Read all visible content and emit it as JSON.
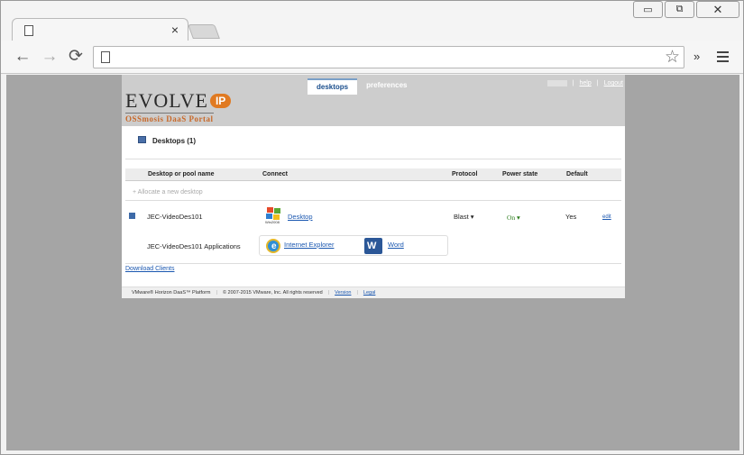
{
  "browser": {
    "tab_close": "×",
    "window_buttons": {
      "minimize": "▭",
      "restore": "⧉",
      "close": "✕"
    },
    "nav": {
      "back": "←",
      "forward": "→",
      "reload": "⟳"
    },
    "star": "☆",
    "overflow": "»"
  },
  "portal": {
    "logo": {
      "brand": "EVOLVE",
      "ip": "IP",
      "subtitle": "OSSmosis DaaS Portal"
    },
    "tabs": [
      {
        "label": "desktops",
        "active": true
      },
      {
        "label": "preferences",
        "active": false
      }
    ],
    "toplinks": {
      "help": "help",
      "logout": "Logout"
    },
    "section_title": "Desktops (1)",
    "table": {
      "headers": {
        "name": "Desktop or pool name",
        "connect": "Connect",
        "protocol": "Protocol",
        "power": "Power state",
        "default": "Default"
      },
      "allocate": "+ Allocate a new desktop",
      "row": {
        "name": "JEC-VideoDes101",
        "os_caption": "Win2008",
        "connect_link": "Desktop",
        "protocol": "Blast ▾",
        "power": "On ▾",
        "default": "Yes",
        "edit": "edit"
      },
      "apps": {
        "label": "JEC-VideoDes101  Applications",
        "items": [
          {
            "name": "Internet Explorer",
            "icon": "internet-explorer-icon"
          },
          {
            "name": "Word",
            "icon": "word-icon"
          }
        ]
      }
    },
    "download_link": "Download Clients",
    "footer": {
      "platform": "VMware® Horizon DaaS™ Platform",
      "copyright": "© 2007-2015 VMware, Inc. All rights reserved",
      "version": "Version",
      "legal": "Legal"
    }
  }
}
